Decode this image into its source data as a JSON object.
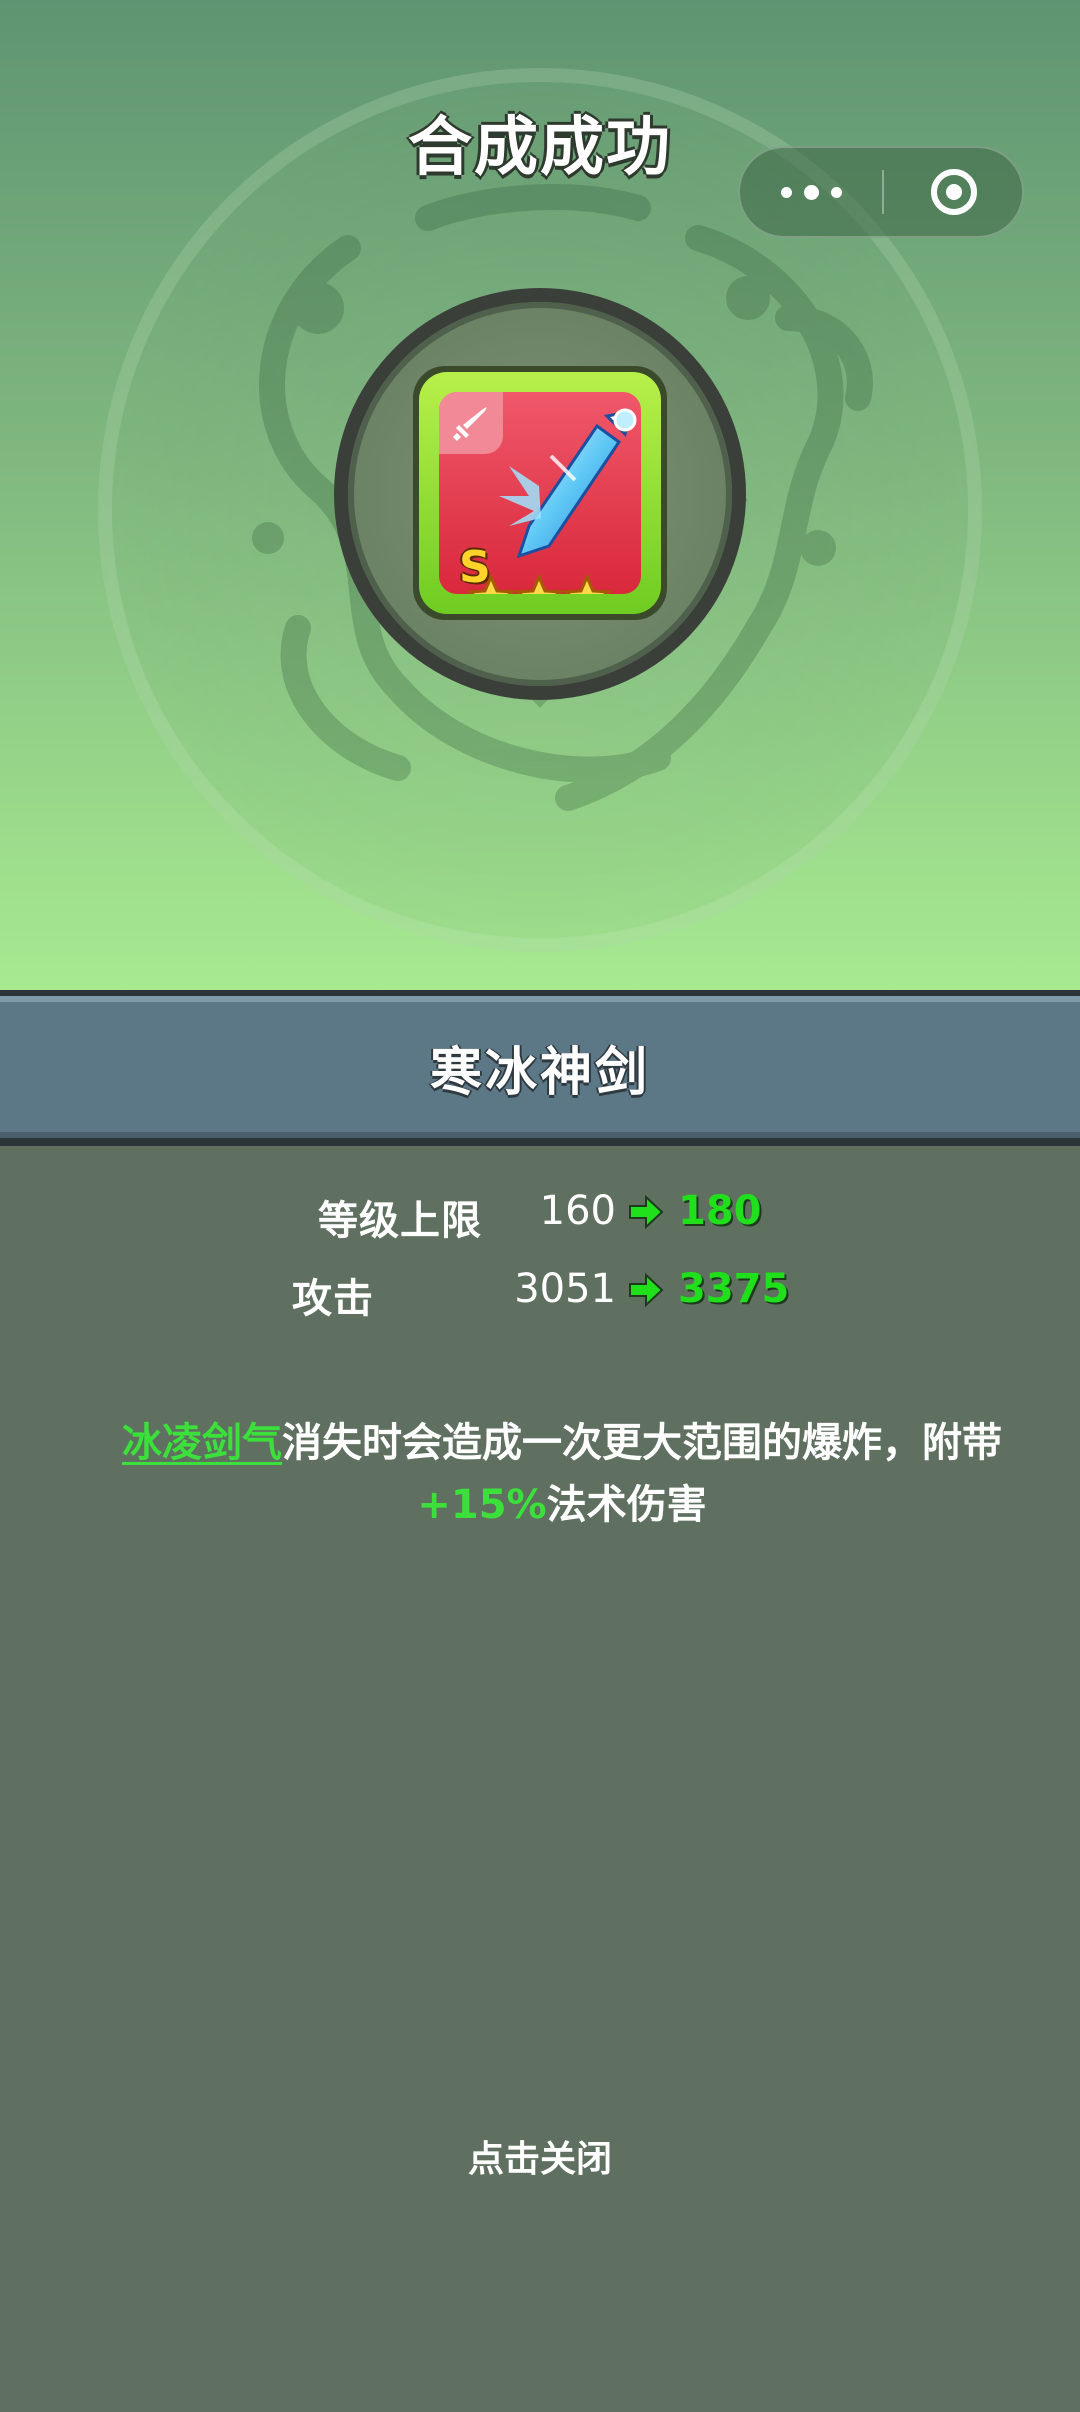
{
  "header": {
    "title": "合成成功"
  },
  "capsule": {
    "more_icon": "more-dots-icon",
    "close_icon": "target-close-icon"
  },
  "item": {
    "grade": "S",
    "stars": 3,
    "type_icon": "sword-type-icon",
    "image_icon": "ice-sword-icon",
    "name": "寒冰神剑"
  },
  "stats": [
    {
      "label": "等级上限",
      "from": "160",
      "to": "180"
    },
    {
      "label": "攻击",
      "from": "3051",
      "to": "3375"
    }
  ],
  "description": {
    "skill": "冰凌剑气",
    "text_a": "消失时会造成一次更大范围的爆炸，附带",
    "bonus": "+15%",
    "text_b": "法术伤害"
  },
  "footer": {
    "close_hint": "点击关闭"
  },
  "colors": {
    "highlight_green": "#3be03a",
    "banner_bg": "#5c7786",
    "lower_bg": "#5f6f60"
  }
}
